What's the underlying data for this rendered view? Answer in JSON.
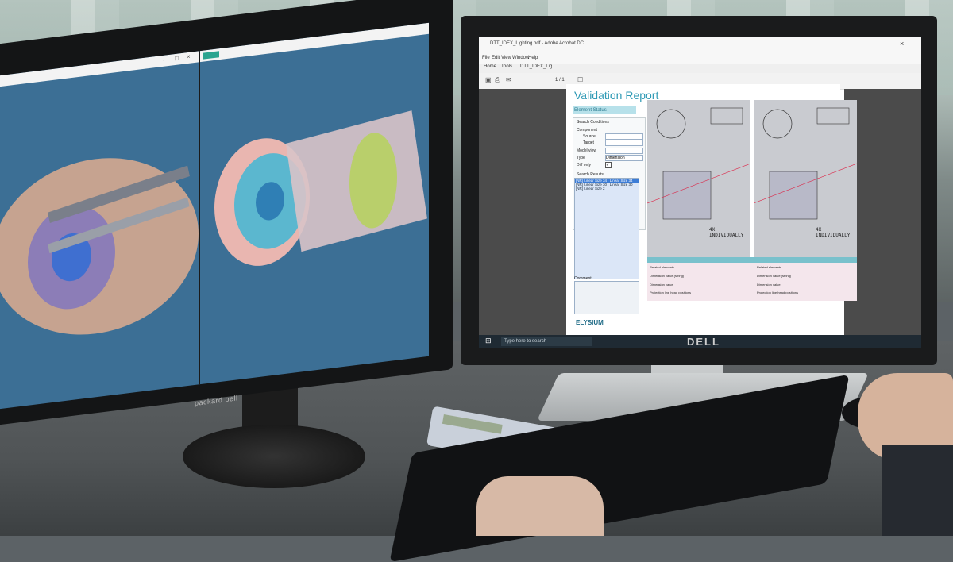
{
  "left_monitor": {
    "brand": "packard bell"
  },
  "right_monitor": {
    "brand": "DELL",
    "acrobat": {
      "window_title": "DTT_IDEX_Lighting.pdf - Adobe Acrobat DC",
      "menu": [
        "File",
        "Edit",
        "View",
        "Window",
        "Help"
      ],
      "tabs": [
        "Home",
        "Tools"
      ],
      "document_tab": "DTT_IDEX_Lig...",
      "page_indicator": "1 / 1"
    },
    "report": {
      "title": "Validation Report",
      "subtitle": "Element Status",
      "search_conditions_label": "Search Conditions",
      "component_label": "Component",
      "source_label": "Source",
      "target_label": "Target",
      "model_view_label": "Model view",
      "type_label": "Type",
      "type_value": "Dimension",
      "diff_only_label": "Diff only",
      "search_results_label": "Search Results",
      "results": [
        "[NR] Linear Size 34 | Linear Size 34",
        "[NR] Linear Size 30 | Linear Size 30",
        "[NR] Linear Size 2"
      ],
      "comment_label": "Comment",
      "logo": "ELYSIUM",
      "drawing_labels": [
        "4X INDIVIDUALLY",
        "4X INDIVIDUALLY"
      ],
      "props": {
        "left_rows": [
          "Related elements",
          "Dimension value (string)",
          "Dimension value",
          "Projection line head positions"
        ],
        "right_rows": [
          "Related elements",
          "Dimension value (string)",
          "Dimension value",
          "Projection line head positions"
        ]
      }
    },
    "taskbar": {
      "search_placeholder": "Type here to search"
    }
  },
  "colors": {
    "left_screen_bg": "#3c6f95",
    "report_accent": "#2f9ab5"
  }
}
